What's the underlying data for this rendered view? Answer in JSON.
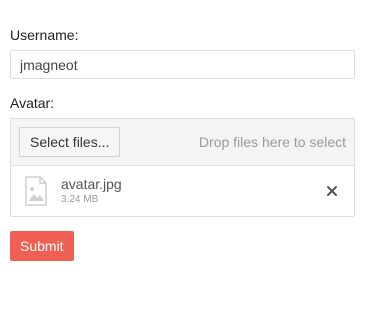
{
  "form": {
    "username_label": "Username:",
    "username_value": "jmagneot",
    "avatar_label": "Avatar:",
    "upload": {
      "select_button_label": "Select files...",
      "drop_hint": "Drop files here to select",
      "files": [
        {
          "name": "avatar.jpg",
          "size": "3.24 MB",
          "icon": "image-file-icon",
          "remove_icon": "close-icon"
        }
      ]
    },
    "submit_label": "Submit"
  },
  "colors": {
    "accent": "#f05f53",
    "border": "#dedede",
    "toolbar_bg": "#f4f4f4",
    "muted_text": "#9a9a9a"
  }
}
